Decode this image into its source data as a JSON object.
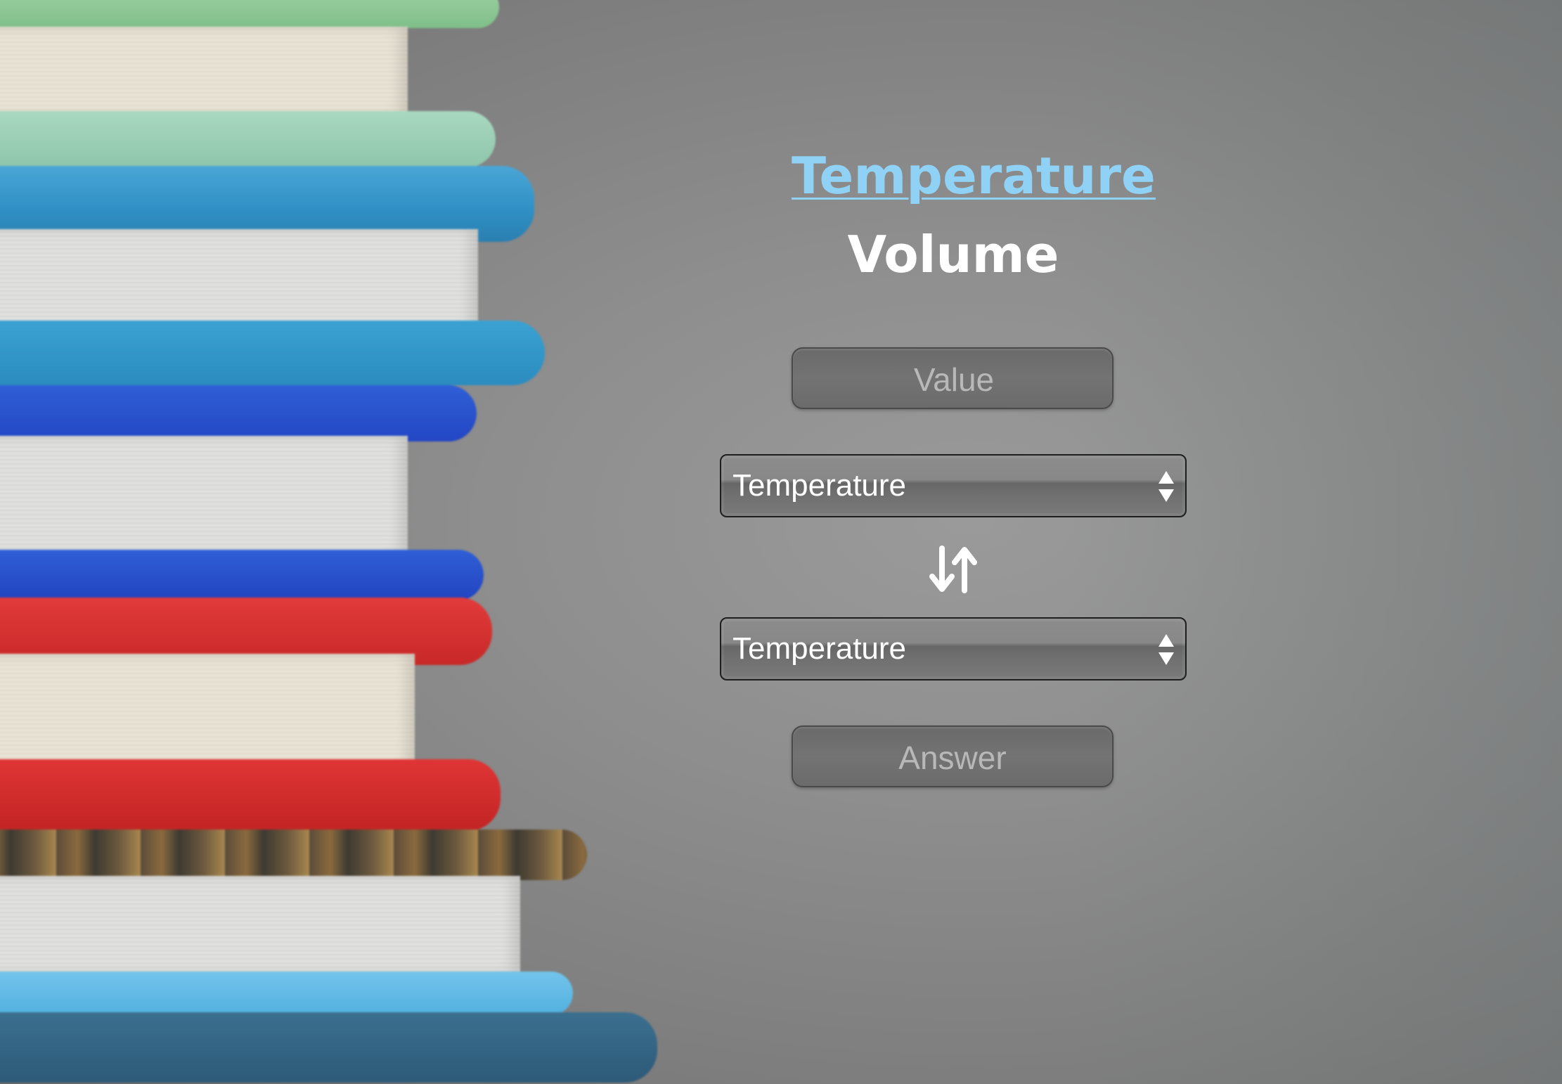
{
  "header": {
    "title_link": "Temperature",
    "subtitle": "Volume"
  },
  "converter": {
    "value_placeholder": "Value",
    "from_unit": "Temperature",
    "to_unit": "Temperature",
    "answer_label": "Answer"
  },
  "icons": {
    "swap": "swap-vertical-arrows-icon",
    "select_arrows": "updown-chevron-icon"
  },
  "colors": {
    "link": "#8fd2f6",
    "heading": "#ffffff",
    "background": "#8c8c8c"
  }
}
